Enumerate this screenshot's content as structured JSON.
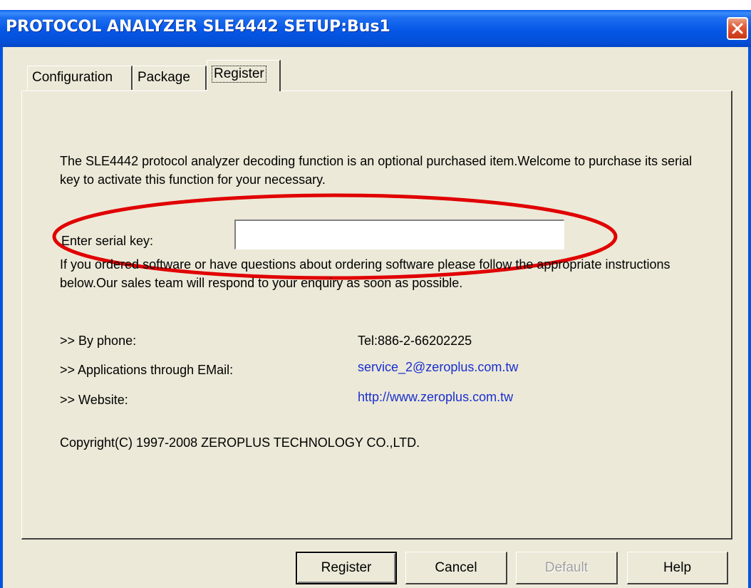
{
  "window": {
    "title": "PROTOCOL ANALYZER SLE4442 SETUP:Bus1"
  },
  "tabs": [
    {
      "label": "Configuration"
    },
    {
      "label": "Package"
    },
    {
      "label": "Register"
    }
  ],
  "register": {
    "intro": "The SLE4442 protocol analyzer decoding function is an optional purchased item.Welcome to purchase its serial key to activate this function for your necessary.",
    "serial_label": "Enter serial key:",
    "serial_value": "",
    "ordered_text": "If you ordered software or have questions about ordering software please follow the appropriate instructions below.Our sales team will respond to your enquiry as soon as possible.",
    "phone_label": ">> By phone:",
    "phone_value": "Tel:886-2-66202225",
    "email_label": ">> Applications through EMail:",
    "email_value": "service_2@zeroplus.com.tw",
    "website_label": ">> Website:",
    "website_value": "http://www.zeroplus.com.tw",
    "copyright": "Copyright(C) 1997-2008 ZEROPLUS TECHNOLOGY CO.,LTD."
  },
  "buttons": {
    "register": "Register",
    "cancel": "Cancel",
    "default": "Default",
    "help": "Help"
  },
  "colors": {
    "titlebar": "#0557e6",
    "face": "#ece9d8",
    "link": "#1a2fd0",
    "annotation": "#e00000"
  }
}
